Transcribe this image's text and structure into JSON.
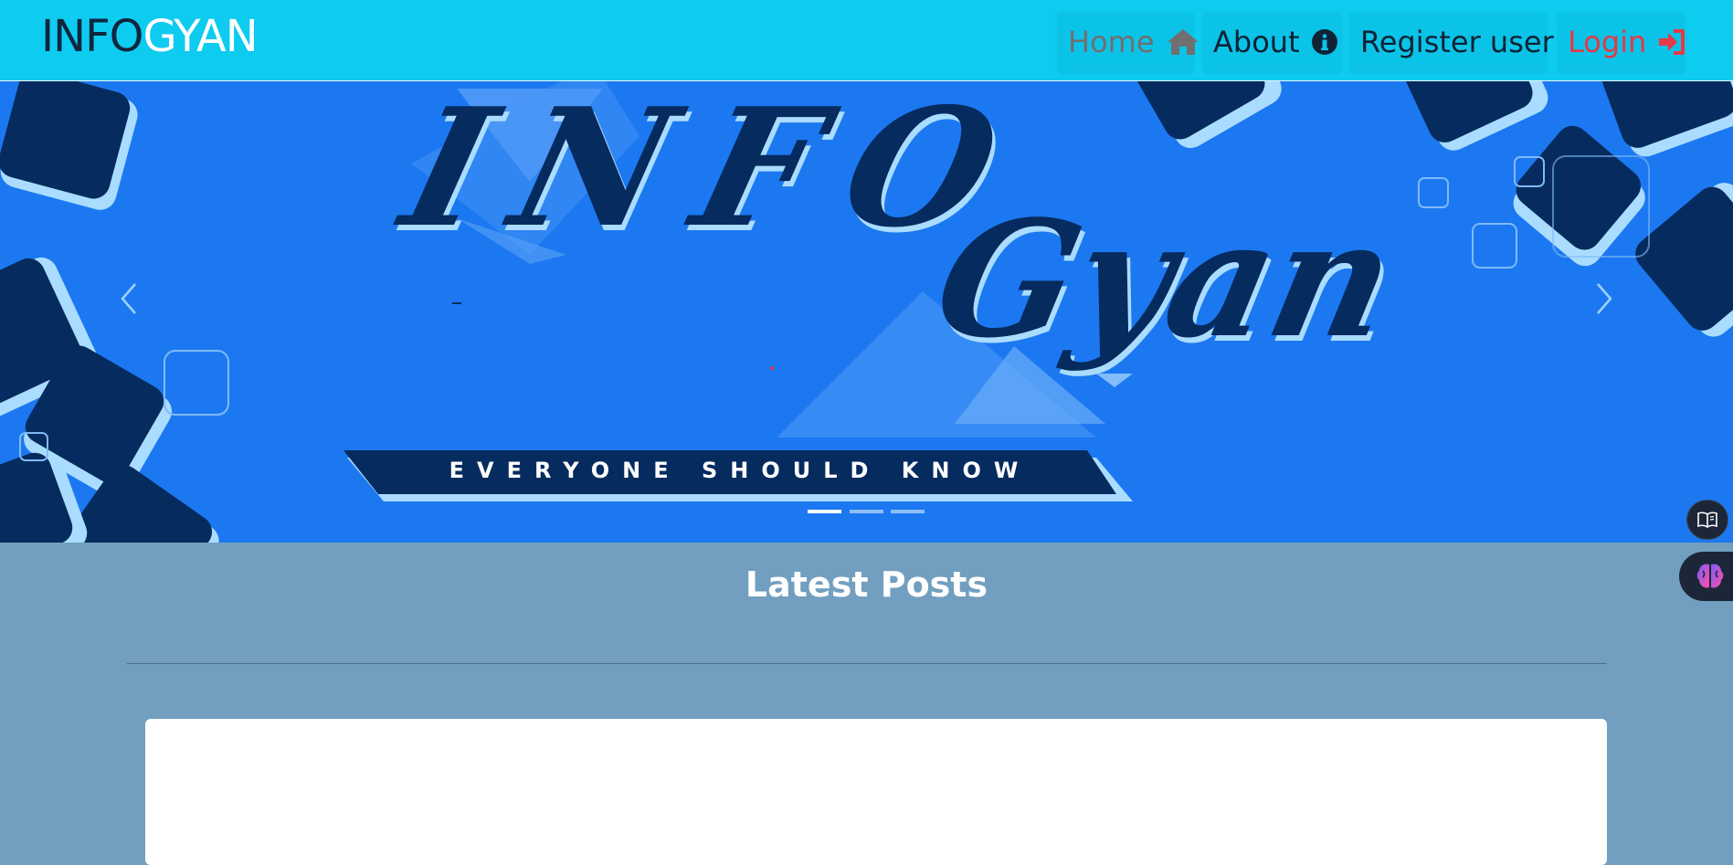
{
  "brand": {
    "part1": "INFO",
    "part2": "GYAN"
  },
  "nav": {
    "home": "Home",
    "about": "About",
    "register": "Register user",
    "login": "Login"
  },
  "hero": {
    "title_line1": "INFO",
    "title_line2": "Gyan",
    "tagline": "EVERYONE SHOULD KNOW",
    "slides": 3,
    "active_slide": 1
  },
  "section": {
    "title": "Latest Posts"
  },
  "colors": {
    "navbar": "#0ecbf0",
    "hero": "#1c78f1",
    "page": "#729fbf",
    "dark_navy": "#062b5e",
    "light_blue": "#a9dcff",
    "login": "#e53945"
  },
  "icons": {
    "home": "home-icon",
    "about": "info-circle-icon",
    "login": "sign-in-icon",
    "reader": "book-icon",
    "ai": "brain-icon"
  }
}
